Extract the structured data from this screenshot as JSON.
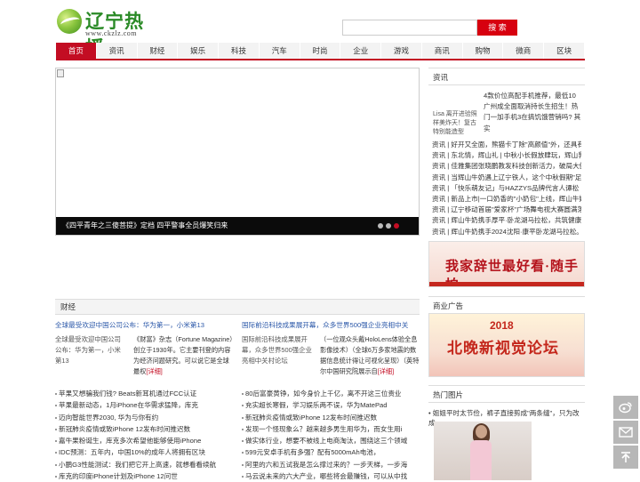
{
  "header": {
    "logo_title": "辽宁热播",
    "logo_url": "www.ckzlz.com",
    "search_placeholder": "",
    "search_button": "搜 索"
  },
  "nav": [
    "首页",
    "资讯",
    "财经",
    "娱乐",
    "科技",
    "汽车",
    "时尚",
    "企业",
    "游戏",
    "商讯",
    "购物",
    "微商",
    "区块"
  ],
  "slider": {
    "caption": "《四平青年之三傻菩提》定档 四平警事全员爆笑归来"
  },
  "news": {
    "heading": "资讯",
    "img_alt": "Lisa 离开进验照样美炸天！复古特别能造型",
    "intro": "4款价位高配手机推荐，最低10 广州成全面取消持长生招生！热门一加手机3在搞饥饿营销吗? 其实",
    "lines": [
      "资讯 | 好开又全面，熊猫卡丁除\"高颜值\"外，还具有硬",
      "资讯 | 东北情，辉山礼 | 中秋小长假放肆玩，辉山乳",
      "资讯 | 佳雅集团张晓鹏教发科技创新活力，破局大健",
      "资讯 | 当辉山牛奶遇上辽宁铁人，这个中秋假期\"足够",
      "资讯 | 「快乐萌友记」与HAZZYS品牌代言人谭松",
      "资讯 | 新品上市|一口奶香的\"小奶包\"上线，辉山牛奶",
      "资讯 | 辽宁移动首届\"爱家杯\"广场舞电视大赛圆满落幕",
      "资讯 | 辉山牛奶携手厚平·卧龙湖马拉松，共筑健康\"骑",
      "资讯 | 辉山牛奶携手2024沈阳·康平卧龙湖马拉松。"
    ]
  },
  "banner1": {
    "text": "我家辞世最好看·随手拍"
  },
  "ad": {
    "heading": "商业广告",
    "year": "2018",
    "title": "北晚新视觉论坛"
  },
  "hot": {
    "heading": "热门图片",
    "caption": "• 姐姐平时太节俭，裤子直接剪成\"两条缝\"，只为改成"
  },
  "finance": {
    "heading": "财经",
    "left": {
      "title": "全球最受欢迎中国公司公布：华为第一，小米第13",
      "img_alt": "全球最受欢迎中国公司公布：华为第一，小米第13",
      "desc": "《财富》杂志（Fortune Magazine）创立于1930年。它主要刊登的内容为经济问题研究。可以说它是全球最权",
      "more": "[详细]",
      "items": [
        "苹果又想骗我们钱? Beats新耳机通过FCC认证",
        "苹果最新动态，1月iPhone在华需求猛降，库克",
        "迈向智能世界2030, 华为与你有约",
        "新冠肺炎疫情或致iPhone 12发布时间推迟数",
        "嘉牛果粉诞生，库克多次希望他能够使用iPhone",
        "IDC预测：五年内，中国10%的成年人将拥有区块",
        "小鹏G3性能测试：我们把它开上高速，就想看看续航",
        "库克的印度iPhone计划及iPhone 12问世"
      ]
    },
    "right": {
      "title": "国际前沿科技成果展开幕，众多世界500强企业亮相中关",
      "img_alt": "国际前沿科技成果展开幕，众多世界500强企业亮相中关村论坛",
      "desc": "（一位观众头戴HoloLens体验全息影像技术）（全球6万多家地震的数据信息统计得让可视化呈现）（英特尔中国研究院展示自",
      "more": "[详细]",
      "items": [
        "80后富豪黄铮，如今身价上千亿，离不开这三位贵业",
        "充实超长寒假，学习娱乐两不误，华为MatePad",
        "新冠肺炎疫情或致iPhone 12发布时间推迟数",
        "发现一个怪现象么？越来越多男生用华为，而女生用i",
        "做实体行业，想要不被线上电商淘汰，围绕这三个领域",
        "599元安卓手机有多强？配有5000mAh电池，",
        "阿里的六和五试我是怎么撑过来的？一步天梯，一步海",
        "马云说未来的六大产业，哪些将会最赚钱，可以从中找"
      ]
    }
  },
  "side_tools": [
    "weibo-icon",
    "mail-icon",
    "back-to-top-icon"
  ]
}
